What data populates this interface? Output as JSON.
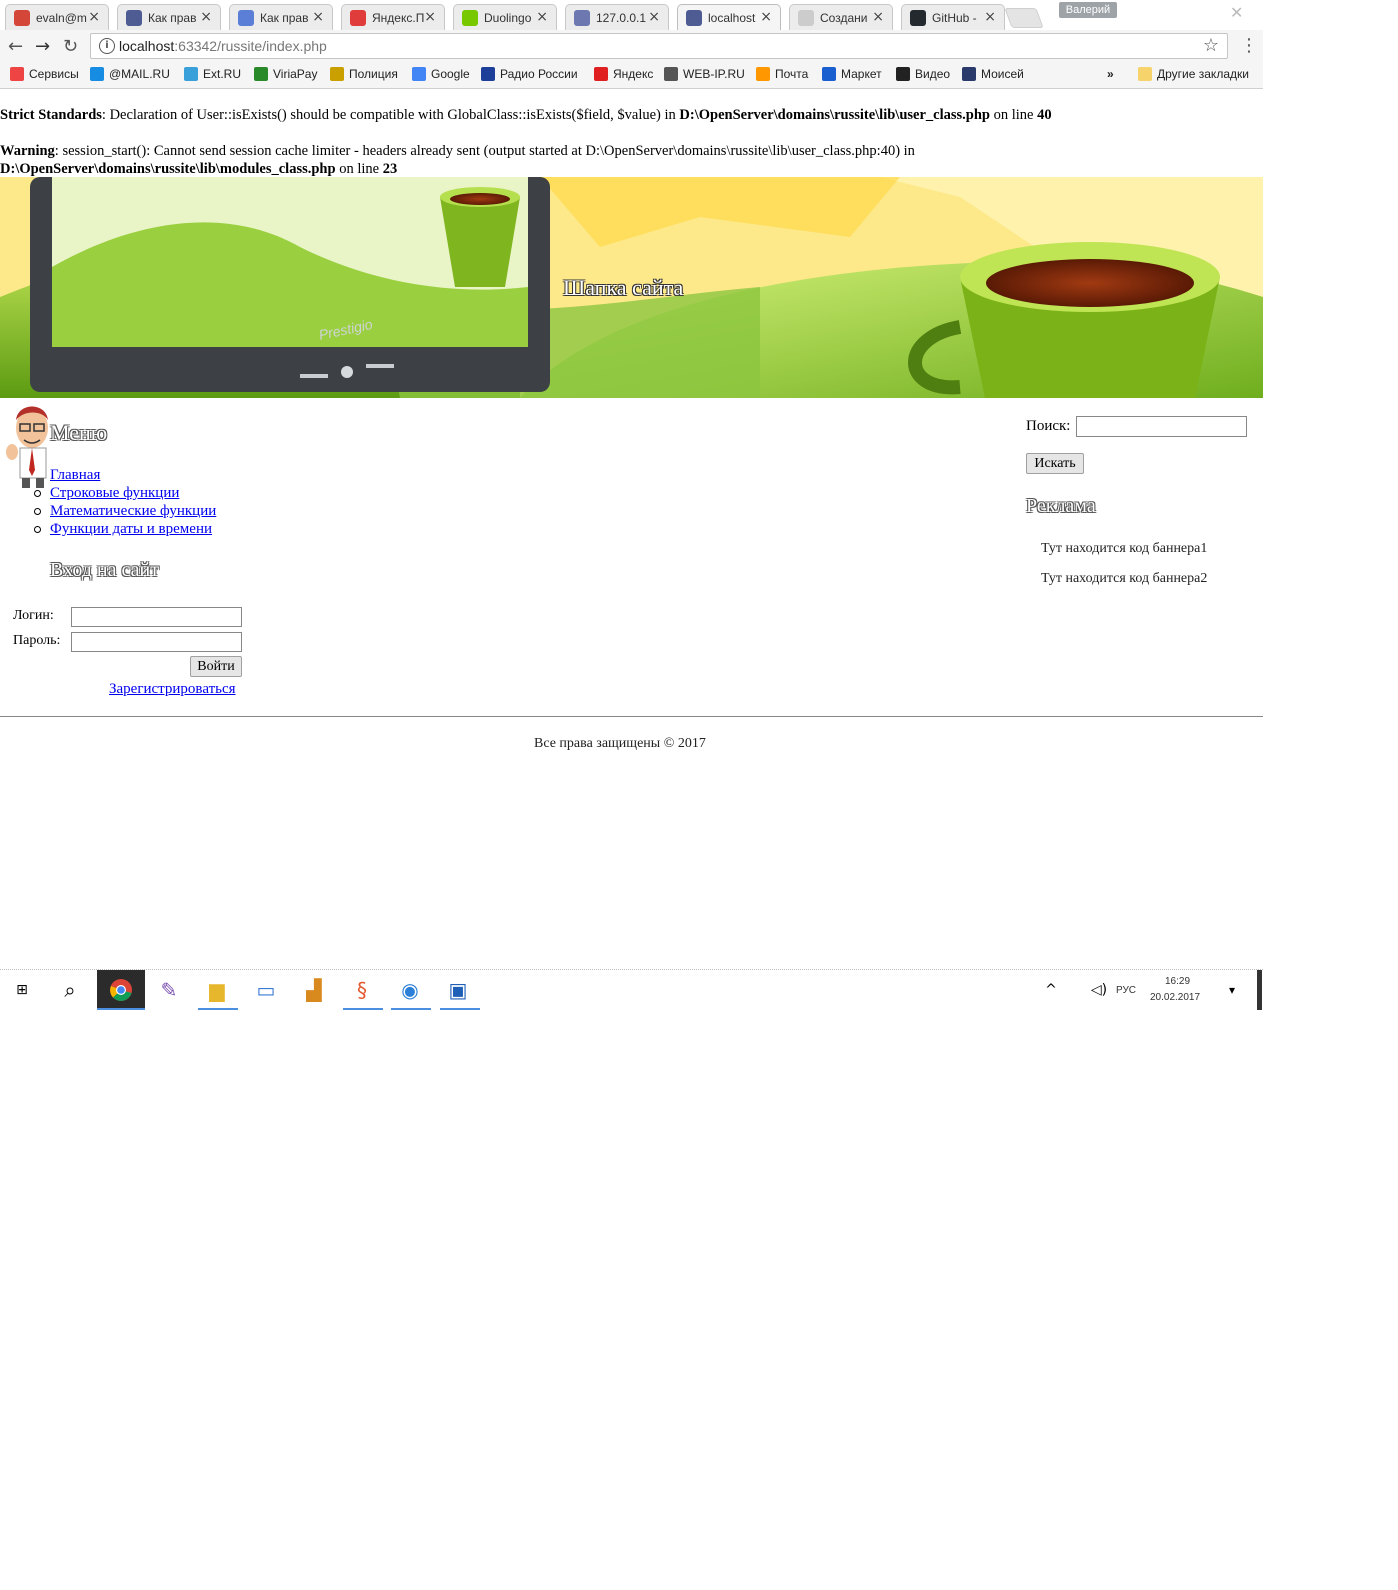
{
  "browser": {
    "tabs": [
      {
        "title": "evaln@m",
        "icon": "mail-icon",
        "color": "#d44638"
      },
      {
        "title": "Как прав",
        "icon": "php-icon",
        "color": "#4f5b93"
      },
      {
        "title": "Как прав",
        "icon": "hub-icon",
        "color": "#5b7fd6"
      },
      {
        "title": "Яндекс.П",
        "icon": "yandex-icon",
        "color": "#e03c3c"
      },
      {
        "title": "Duolingo",
        "icon": "duolingo-icon",
        "color": "#78c800"
      },
      {
        "title": "127.0.0.1",
        "icon": "pma-icon",
        "color": "#6c78af"
      },
      {
        "title": "localhost",
        "icon": "php-icon",
        "color": "#4f5b93"
      },
      {
        "title": "Создани",
        "icon": "page-icon",
        "color": "#cccccc"
      },
      {
        "title": "GitHub -",
        "icon": "github-icon",
        "color": "#24292e"
      }
    ],
    "profile_name": "Валерий",
    "url_host": "localhost",
    "url_rest": ":63342/russite/index.php",
    "bookmarks": [
      {
        "label": "Сервисы",
        "color": "#e44"
      },
      {
        "label": "@MAIL.RU",
        "color": "#168de2"
      },
      {
        "label": "Ext.RU",
        "color": "#3aa0d9"
      },
      {
        "label": "ViriaPay",
        "color": "#2a8a2a"
      },
      {
        "label": "Полиция",
        "color": "#c9a000"
      },
      {
        "label": "Google",
        "color": "#4285f4"
      },
      {
        "label": "Радио России",
        "color": "#1e3f99"
      },
      {
        "label": "Яндекс",
        "color": "#e02020"
      },
      {
        "label": "WEB-IP.RU",
        "color": "#555555"
      },
      {
        "label": "Почта",
        "color": "#ff9800"
      },
      {
        "label": "Маркет",
        "color": "#1a5fcf"
      },
      {
        "label": "Видео",
        "color": "#222222"
      },
      {
        "label": "Моисей",
        "color": "#2a3a6a"
      }
    ],
    "overflow": "»",
    "other_bookmarks": "Другие закладки"
  },
  "errors": {
    "strict_label": "Strict Standards",
    "strict_text": ": Declaration of User::isExists() should be compatible with GlobalClass::isExists($field, $value) in ",
    "strict_path": "D:\\OpenServer\\domains\\russite\\lib\\user_class.php",
    "strict_line": " on line ",
    "strict_num": "40",
    "warning_label": "Warning",
    "warning_text": ": session_start(): Cannot send session cache limiter - headers already sent (output started at D:\\OpenServer\\domains\\russite\\lib\\user_class.php:40) in",
    "warning_path": "D:\\OpenServer\\domains\\russite\\lib\\modules_class.php",
    "warning_line": " on line ",
    "warning_num": "23"
  },
  "header": {
    "title": "Шапка сайта",
    "monitor_brand": "Prestigio"
  },
  "sidebar": {
    "menu_title": "Меню",
    "menu_items": [
      "Главная",
      "Строковые функции",
      "Математические функции",
      "Функции даты и времени"
    ],
    "login_title": "Вход на сайт",
    "login_label": "Логин:",
    "password_label": "Пароль:",
    "login_button": "Войти",
    "register_link": "Зарегистрироваться"
  },
  "right": {
    "search_label": "Поиск:",
    "search_button": "Искать",
    "ads_title": "Реклама",
    "banners": [
      "Тут находится код баннера1",
      "Тут находится код баннера2"
    ]
  },
  "footer": {
    "text": "Все права защищены © 2017"
  },
  "taskbar": {
    "tray_lang": "РУС",
    "tray_time": "16:29",
    "tray_date": "20.02.2017"
  }
}
